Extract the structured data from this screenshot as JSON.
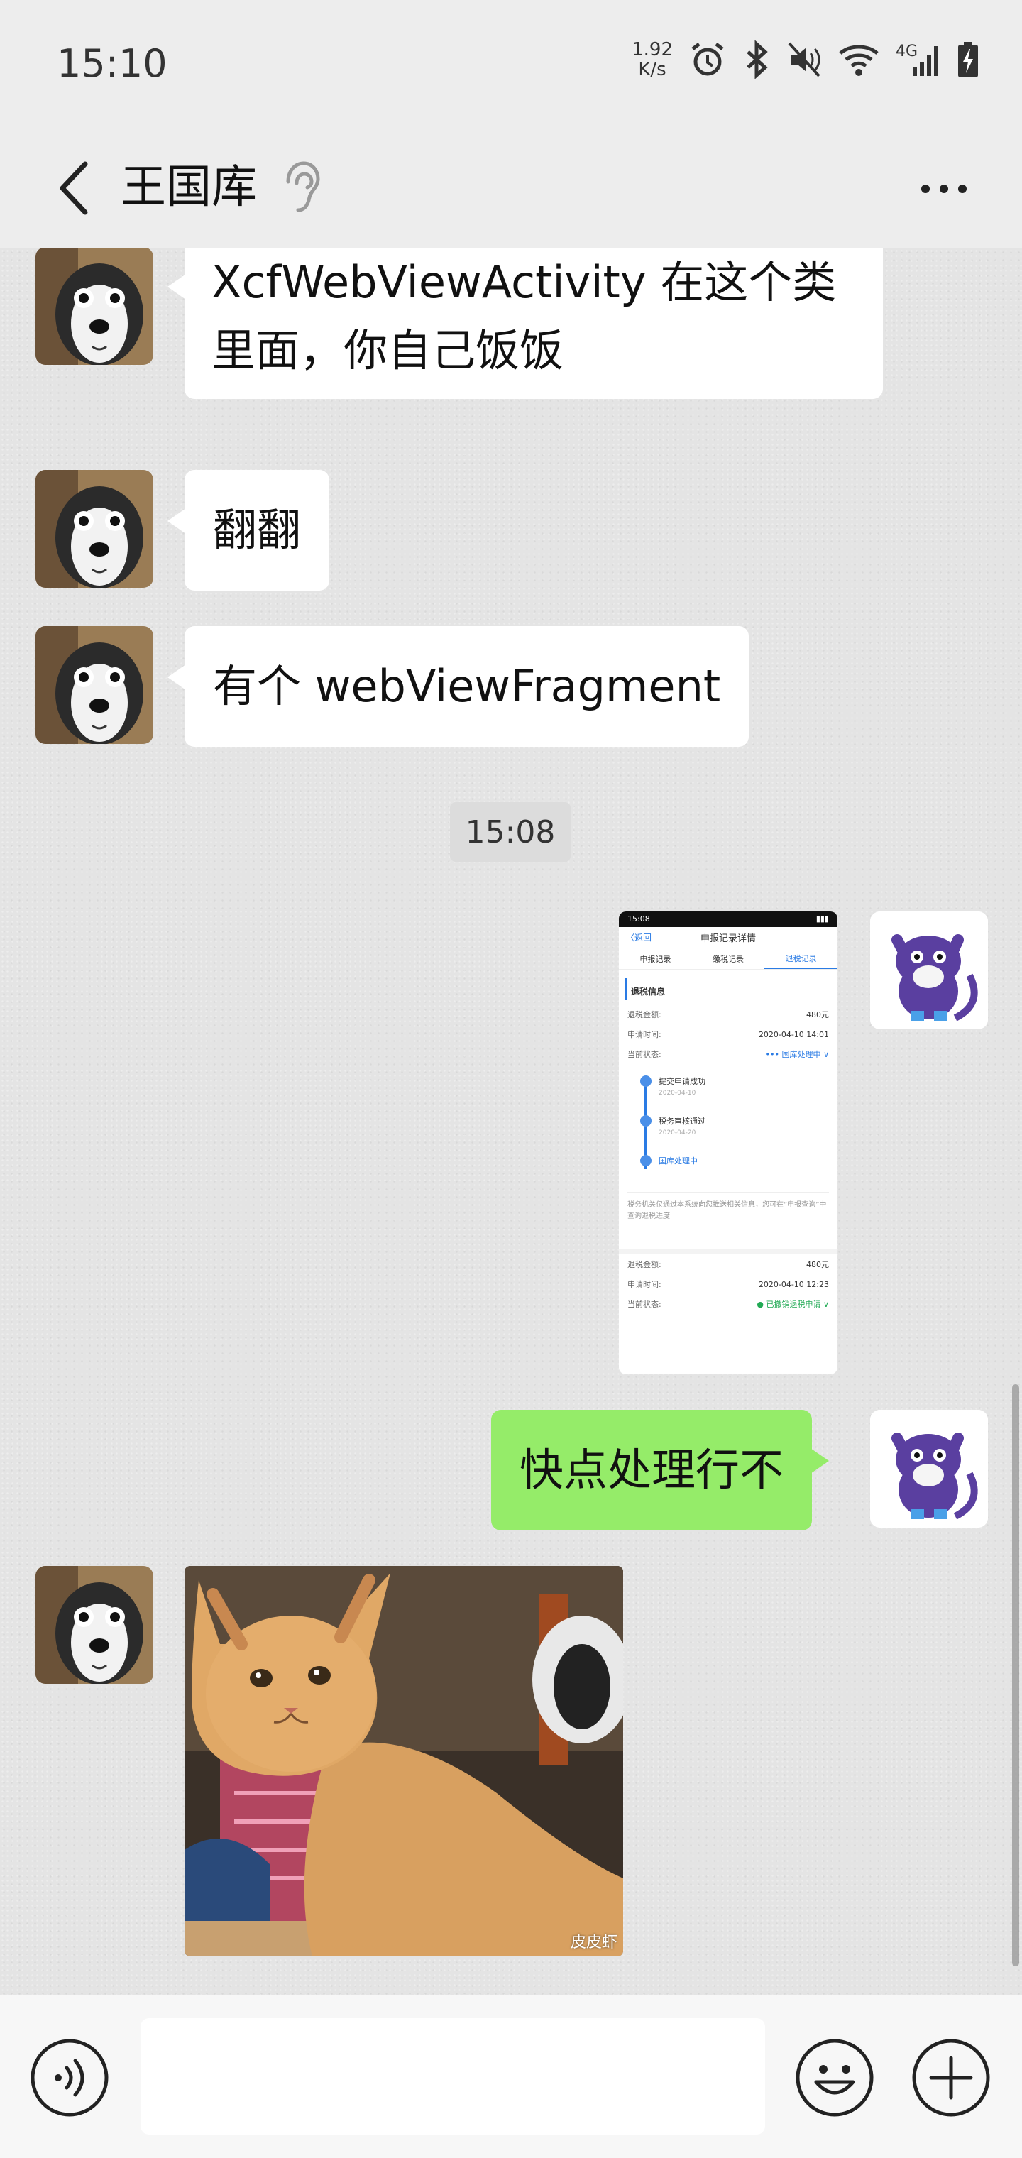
{
  "status_bar": {
    "time": "15:10",
    "net_speed_value": "1.92",
    "net_speed_unit": "K/s",
    "network": "4G",
    "icons": [
      "alarm-icon",
      "bluetooth-icon",
      "mute-icon",
      "wifi-icon",
      "signal-icon",
      "battery-charging-icon"
    ]
  },
  "header": {
    "title": "王国库",
    "icons": [
      "back-arrow-icon",
      "ear-icon",
      "more-icon"
    ]
  },
  "messages": [
    {
      "side": "left",
      "type": "text",
      "line1": "XcfWebViewActivity 在这个类",
      "line2": "里面，你自己饭饭"
    },
    {
      "side": "left",
      "type": "text",
      "text": "翻翻"
    },
    {
      "side": "left",
      "type": "text",
      "text": "有个 webViewFragment"
    },
    {
      "type": "timestamp",
      "text": "15:08"
    },
    {
      "side": "right",
      "type": "image-screenshot"
    },
    {
      "side": "right",
      "type": "text",
      "text": "快点处理行不"
    },
    {
      "side": "left",
      "type": "image-photo",
      "watermark": "皮皮虾"
    }
  ],
  "screenshot": {
    "time": "15:08",
    "back": "〈返回",
    "title": "申报记录详情",
    "tabs": [
      "申报记录",
      "缴税记录",
      "退税记录"
    ],
    "section": "退税信息",
    "rows1": [
      {
        "label": "退税金额:",
        "value": "480元"
      },
      {
        "label": "申请时间:",
        "value": "2020-04-10 14:01"
      },
      {
        "label": "当前状态:",
        "value": "••• 国库处理中 ∨"
      }
    ],
    "steps": [
      {
        "label": "提交申请成功",
        "date": "2020-04-10"
      },
      {
        "label": "税务审核通过",
        "date": "2020-04-20"
      },
      {
        "label": "国库处理中",
        "date": ""
      }
    ],
    "note": "税务机关仅通过本系统向您推送相关信息，您可在“申报查询”中查询退税进度",
    "rows2": [
      {
        "label": "退税金额:",
        "value": "480元"
      },
      {
        "label": "申请时间:",
        "value": "2020-04-10 12:23"
      },
      {
        "label": "当前状态:",
        "value": "● 已撤销退税申请 ∨"
      }
    ]
  },
  "input_bar": {
    "placeholder": "",
    "icons": [
      "voice-icon",
      "emoji-icon",
      "plus-icon"
    ]
  },
  "colors": {
    "right_bubble": "#95ec69",
    "left_bubble": "#ffffff",
    "chat_bg": "#e4e4e4"
  }
}
